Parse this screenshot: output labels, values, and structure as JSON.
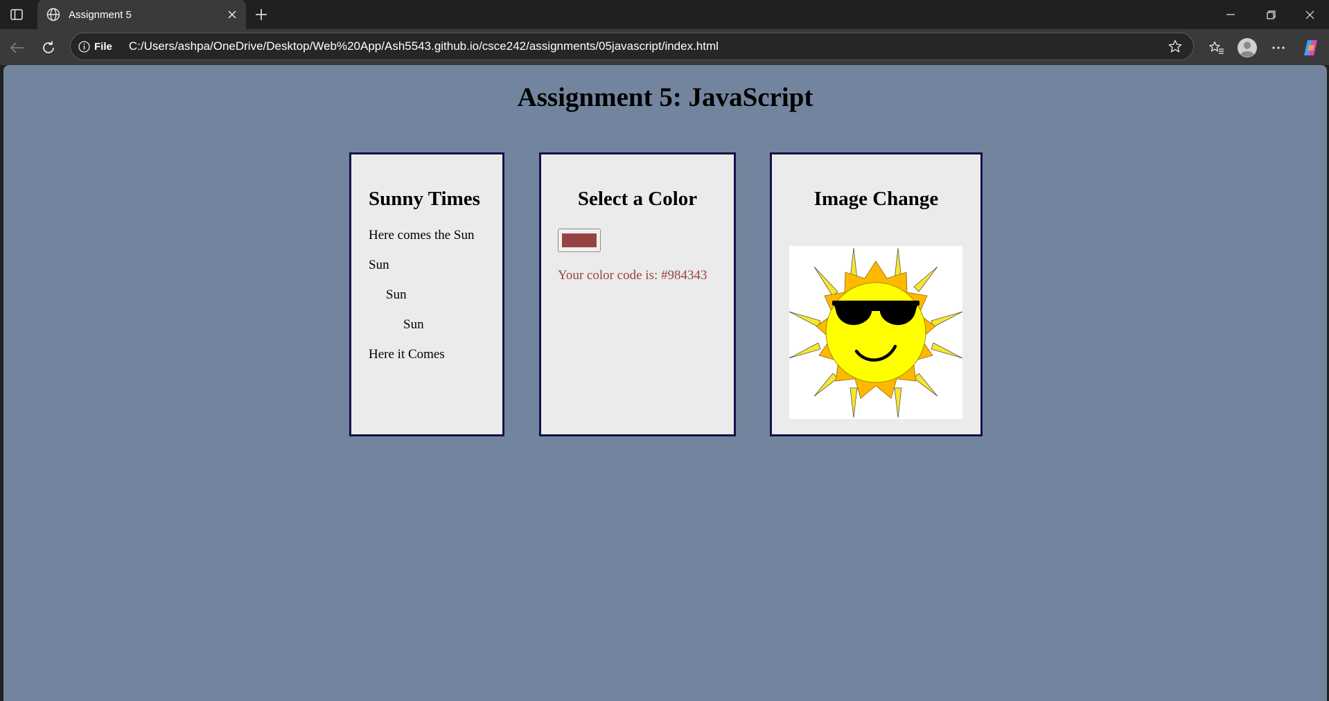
{
  "browser": {
    "tab_title": "Assignment 5",
    "address_scheme": "File",
    "url": "C:/Users/ashpa/OneDrive/Desktop/Web%20App/Ash5543.github.io/csce242/assignments/05javascript/index.html"
  },
  "page": {
    "title": "Assignment 5: JavaScript",
    "background": "#73859e"
  },
  "cards": {
    "sunny": {
      "heading": "Sunny Times",
      "lines": [
        "Here comes the Sun",
        "Sun",
        "Sun",
        "Sun",
        "Here it Comes"
      ]
    },
    "color": {
      "heading": "Select a Color",
      "message": "Your color code is: #984343",
      "selected_color": "#984343"
    },
    "image": {
      "heading": "Image Change",
      "image_icon": "sun-with-sunglasses"
    }
  }
}
